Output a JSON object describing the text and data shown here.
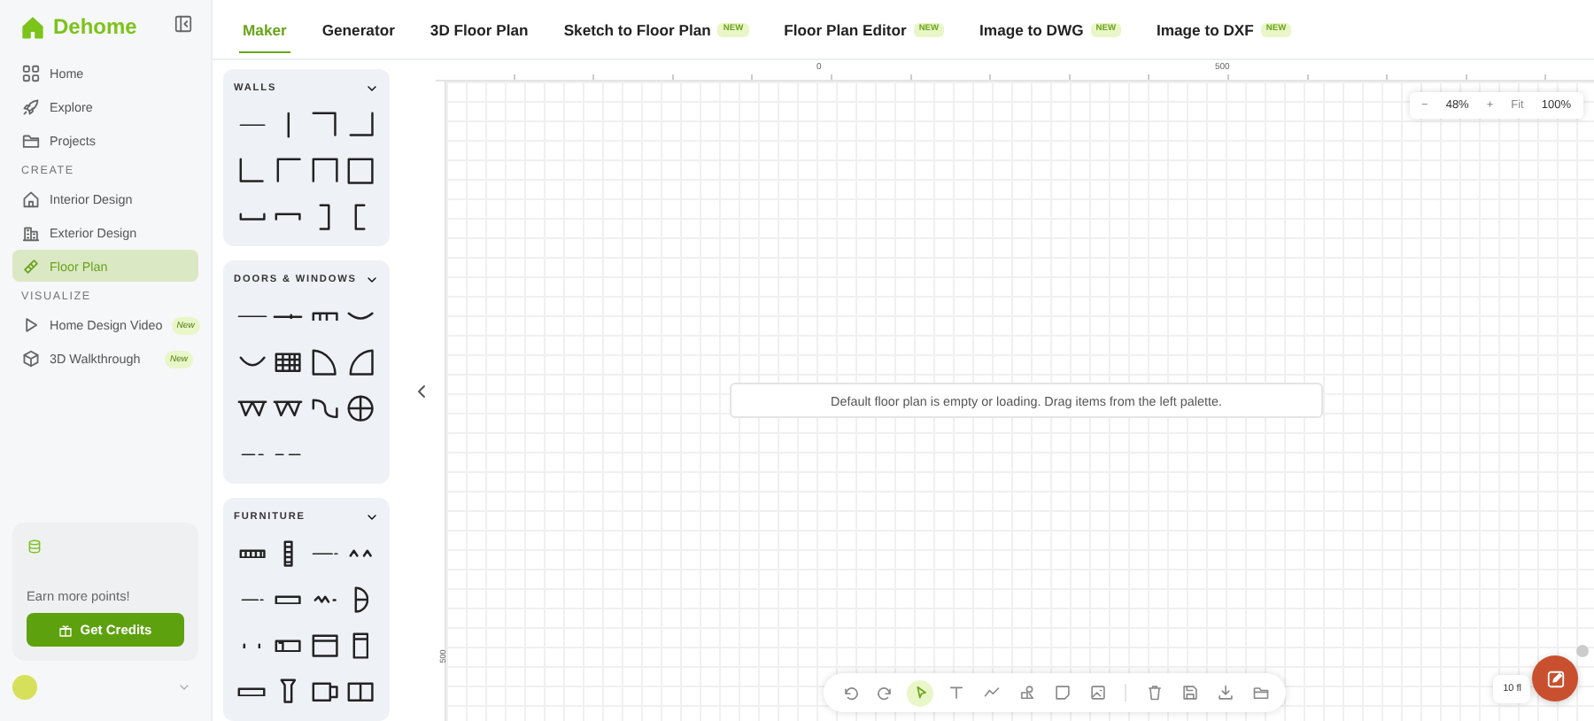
{
  "brand": {
    "name": "Dehome"
  },
  "nav": [
    {
      "kind": "link",
      "label": "Home",
      "selected": false
    },
    {
      "kind": "link",
      "label": "Explore",
      "selected": false
    },
    {
      "kind": "link",
      "label": "Projects",
      "selected": false
    },
    {
      "kind": "heading",
      "label": "CREATE"
    },
    {
      "kind": "link",
      "label": "Interior Design",
      "selected": false
    },
    {
      "kind": "link",
      "label": "Exterior Design",
      "selected": false
    },
    {
      "kind": "link",
      "label": "Floor Plan",
      "selected": true
    },
    {
      "kind": "heading",
      "label": "VISUALIZE"
    },
    {
      "kind": "link",
      "label": "Home Design Video",
      "selected": false,
      "badge": "New"
    },
    {
      "kind": "link",
      "label": "3D Walkthrough",
      "selected": false,
      "badge": "New"
    }
  ],
  "credits": {
    "text": "Earn more points!",
    "button": "Get Credits"
  },
  "tabs": [
    {
      "label": "Maker",
      "selected": true
    },
    {
      "label": "Generator",
      "selected": false
    },
    {
      "label": "3D Floor Plan",
      "selected": false
    },
    {
      "label": "Sketch to Floor Plan",
      "selected": false,
      "badge": "NEW"
    },
    {
      "label": "Floor Plan Editor",
      "selected": false,
      "badge": "NEW"
    },
    {
      "label": "Image to DWG",
      "selected": false,
      "badge": "NEW"
    },
    {
      "label": "Image to DXF",
      "selected": false,
      "badge": "NEW"
    }
  ],
  "palette": [
    {
      "title": "WALLS"
    },
    {
      "title": "DOORS & WINDOWS"
    },
    {
      "title": "FURNITURE"
    }
  ],
  "canvas": {
    "top_ruler": [
      "0",
      "500"
    ],
    "left_ruler": [
      "500"
    ],
    "message": "Default floor plan is empty or loading. Drag items from the left palette.",
    "zoom": {
      "minus": "−",
      "value": "48%",
      "plus": "+",
      "fit": "Fit",
      "full": "100%"
    },
    "tools": [
      {
        "selected": false
      },
      {
        "selected": false
      },
      {
        "selected": true
      },
      {
        "selected": false
      },
      {
        "selected": false
      },
      {
        "selected": false
      },
      {
        "selected": false
      },
      {
        "selected": false
      },
      {
        "selected": false
      },
      {
        "selected": false
      },
      {
        "selected": false
      },
      {
        "selected": false
      }
    ],
    "floor_chip": "10 fl"
  }
}
